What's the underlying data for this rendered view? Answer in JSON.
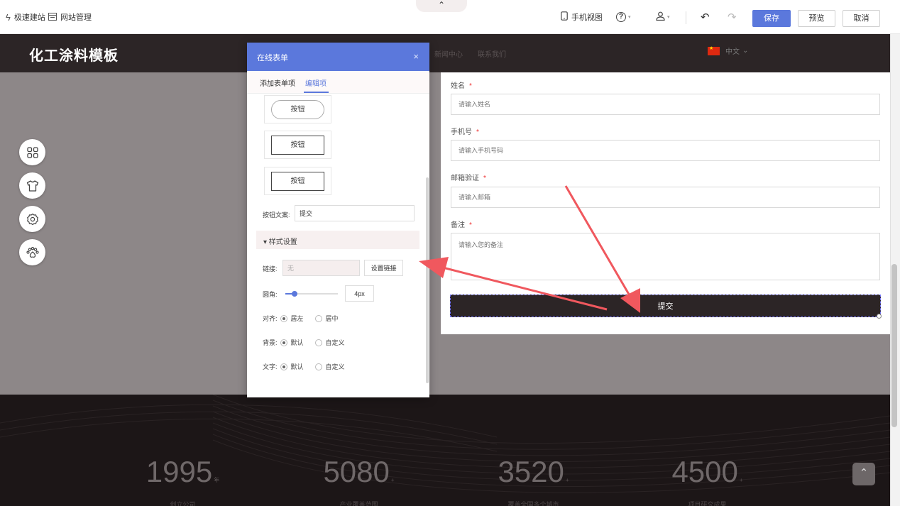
{
  "toolbar": {
    "quick_build": "极速建站",
    "site_manage": "网站管理",
    "collapse_glyph": "⌃",
    "mobile_view": "手机视图",
    "help_glyph": "?",
    "user_glyph": "👤",
    "undo_glyph": "↶",
    "redo_glyph": "↷",
    "save": "保存",
    "preview": "预览",
    "cancel": "取消"
  },
  "site": {
    "logo": "化工涂料模板",
    "nav_ghost_1": "新闻中心",
    "nav_ghost_2": "联系我们",
    "lang": "中文",
    "lang_caret": "⌄"
  },
  "form": {
    "fields": [
      {
        "label": "姓名",
        "required": "*",
        "placeholder": "请输入姓名"
      },
      {
        "label": "手机号",
        "required": "*",
        "placeholder": "请输入手机号码"
      },
      {
        "label": "邮箱验证",
        "required": "*",
        "placeholder": "请输入邮箱"
      },
      {
        "label": "备注",
        "required": "*",
        "placeholder": "请输入您的备注"
      }
    ],
    "submit": "提交"
  },
  "stats": [
    {
      "num": "1995",
      "suffix": "年",
      "caption": "创立公司"
    },
    {
      "num": "5080",
      "suffix": "+",
      "caption": "产业覆盖范围"
    },
    {
      "num": "3520",
      "suffix": "+",
      "caption": "覆盖全国多个城市"
    },
    {
      "num": "4500",
      "suffix": "+",
      "caption": "项目研究成果"
    }
  ],
  "back_to_top": "⌃",
  "dialog": {
    "title": "在线表单",
    "close": "×",
    "tabs": [
      "添加表单项",
      "编辑项"
    ],
    "active_tab": "编辑项",
    "button_samples": [
      "按钮",
      "按钮",
      "按钮"
    ],
    "button_text_label": "按钮文案:",
    "button_text_value": "提交",
    "style_section": "▾ 样式设置",
    "link_label": "链接:",
    "link_value": "无",
    "set_link": "设置链接",
    "radius_label": "圆角:",
    "radius_value": "4px",
    "radius_fraction": 0.18,
    "align_label": "对齐:",
    "align_options": [
      "居左",
      "居中"
    ],
    "align_selected": "居左",
    "bg_label": "背景:",
    "bg_options": [
      "默认",
      "自定义"
    ],
    "bg_selected": "默认",
    "text_label": "文字:",
    "text_options": [
      "默认",
      "自定义"
    ],
    "text_selected": "默认"
  },
  "colors": {
    "accent": "#5b78dc",
    "nav_dark": "#2c2526",
    "annotation_arrow": "#f0585e"
  }
}
